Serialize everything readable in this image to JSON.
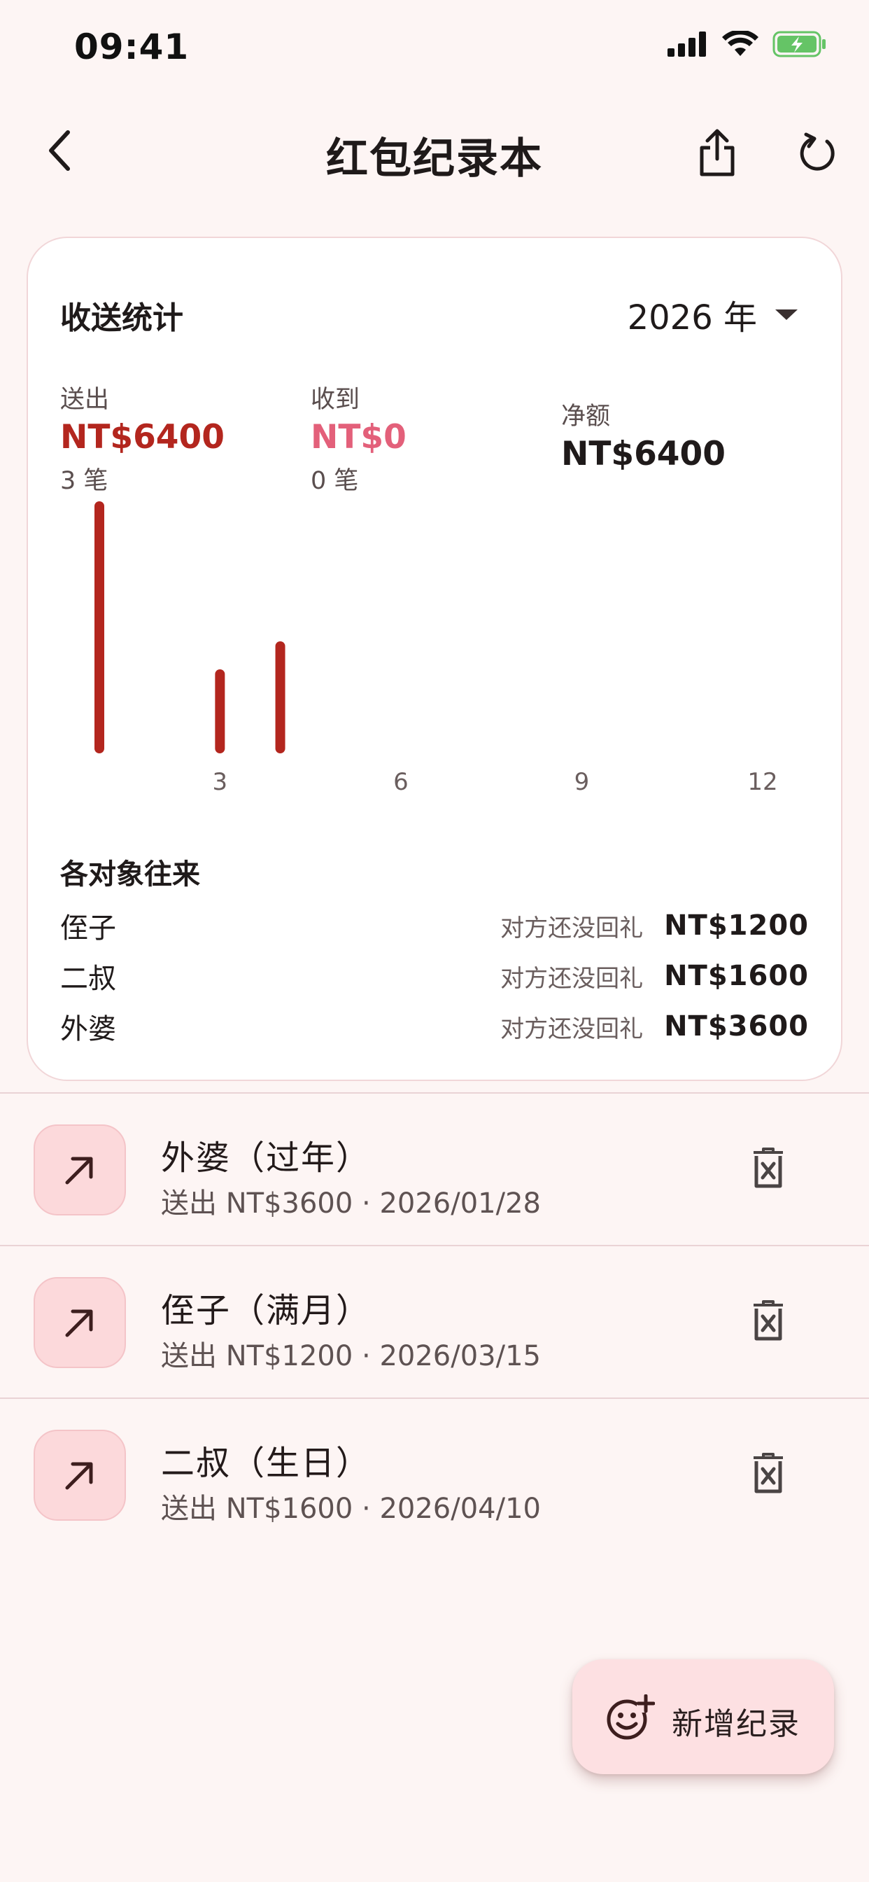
{
  "status_bar": {
    "time": "09:41",
    "icons": [
      "signal-icon",
      "wifi-icon",
      "battery-charging-icon"
    ]
  },
  "app_bar": {
    "title": "红包纪录本",
    "icons": [
      "back-arrow-icon",
      "share-icon",
      "refresh-icon"
    ]
  },
  "stats": {
    "title": "收送统计",
    "year": "2026 年",
    "sent": {
      "label": "送出",
      "value": "NT$6400",
      "count": "3 笔"
    },
    "received": {
      "label": "收到",
      "value": "NT$0",
      "count": "0 笔"
    },
    "net": {
      "label": "净额",
      "value": "NT$6400"
    },
    "colors": {
      "sent": "#b3261e",
      "received": "#e3607a"
    }
  },
  "chart_data": {
    "type": "bar",
    "x_ticks": [
      "3",
      "6",
      "9",
      "12"
    ],
    "xlim": [
      0,
      12
    ],
    "months": [
      1,
      3,
      4
    ],
    "values": [
      3600,
      1200,
      1600
    ],
    "ylim": [
      0,
      3600
    ],
    "bar_color": "#b3261e",
    "grid": false
  },
  "counterparts": {
    "title": "各对象往来",
    "rows": [
      {
        "name": "侄子",
        "status": "对方还没回礼",
        "amount": "NT$1200"
      },
      {
        "name": "二叔",
        "status": "对方还没回礼",
        "amount": "NT$1600"
      },
      {
        "name": "外婆",
        "status": "对方还没回礼",
        "amount": "NT$3600"
      }
    ]
  },
  "records": [
    {
      "title": "外婆（过年）",
      "subtitle": "送出 NT$3600 · 2026/01/28"
    },
    {
      "title": "侄子（满月）",
      "subtitle": "送出 NT$1200 · 2026/03/15"
    },
    {
      "title": "二叔（生日）",
      "subtitle": "送出 NT$1600 · 2026/04/10"
    }
  ],
  "fab": {
    "label": "新增纪录",
    "icon": "add-reaction-icon"
  }
}
